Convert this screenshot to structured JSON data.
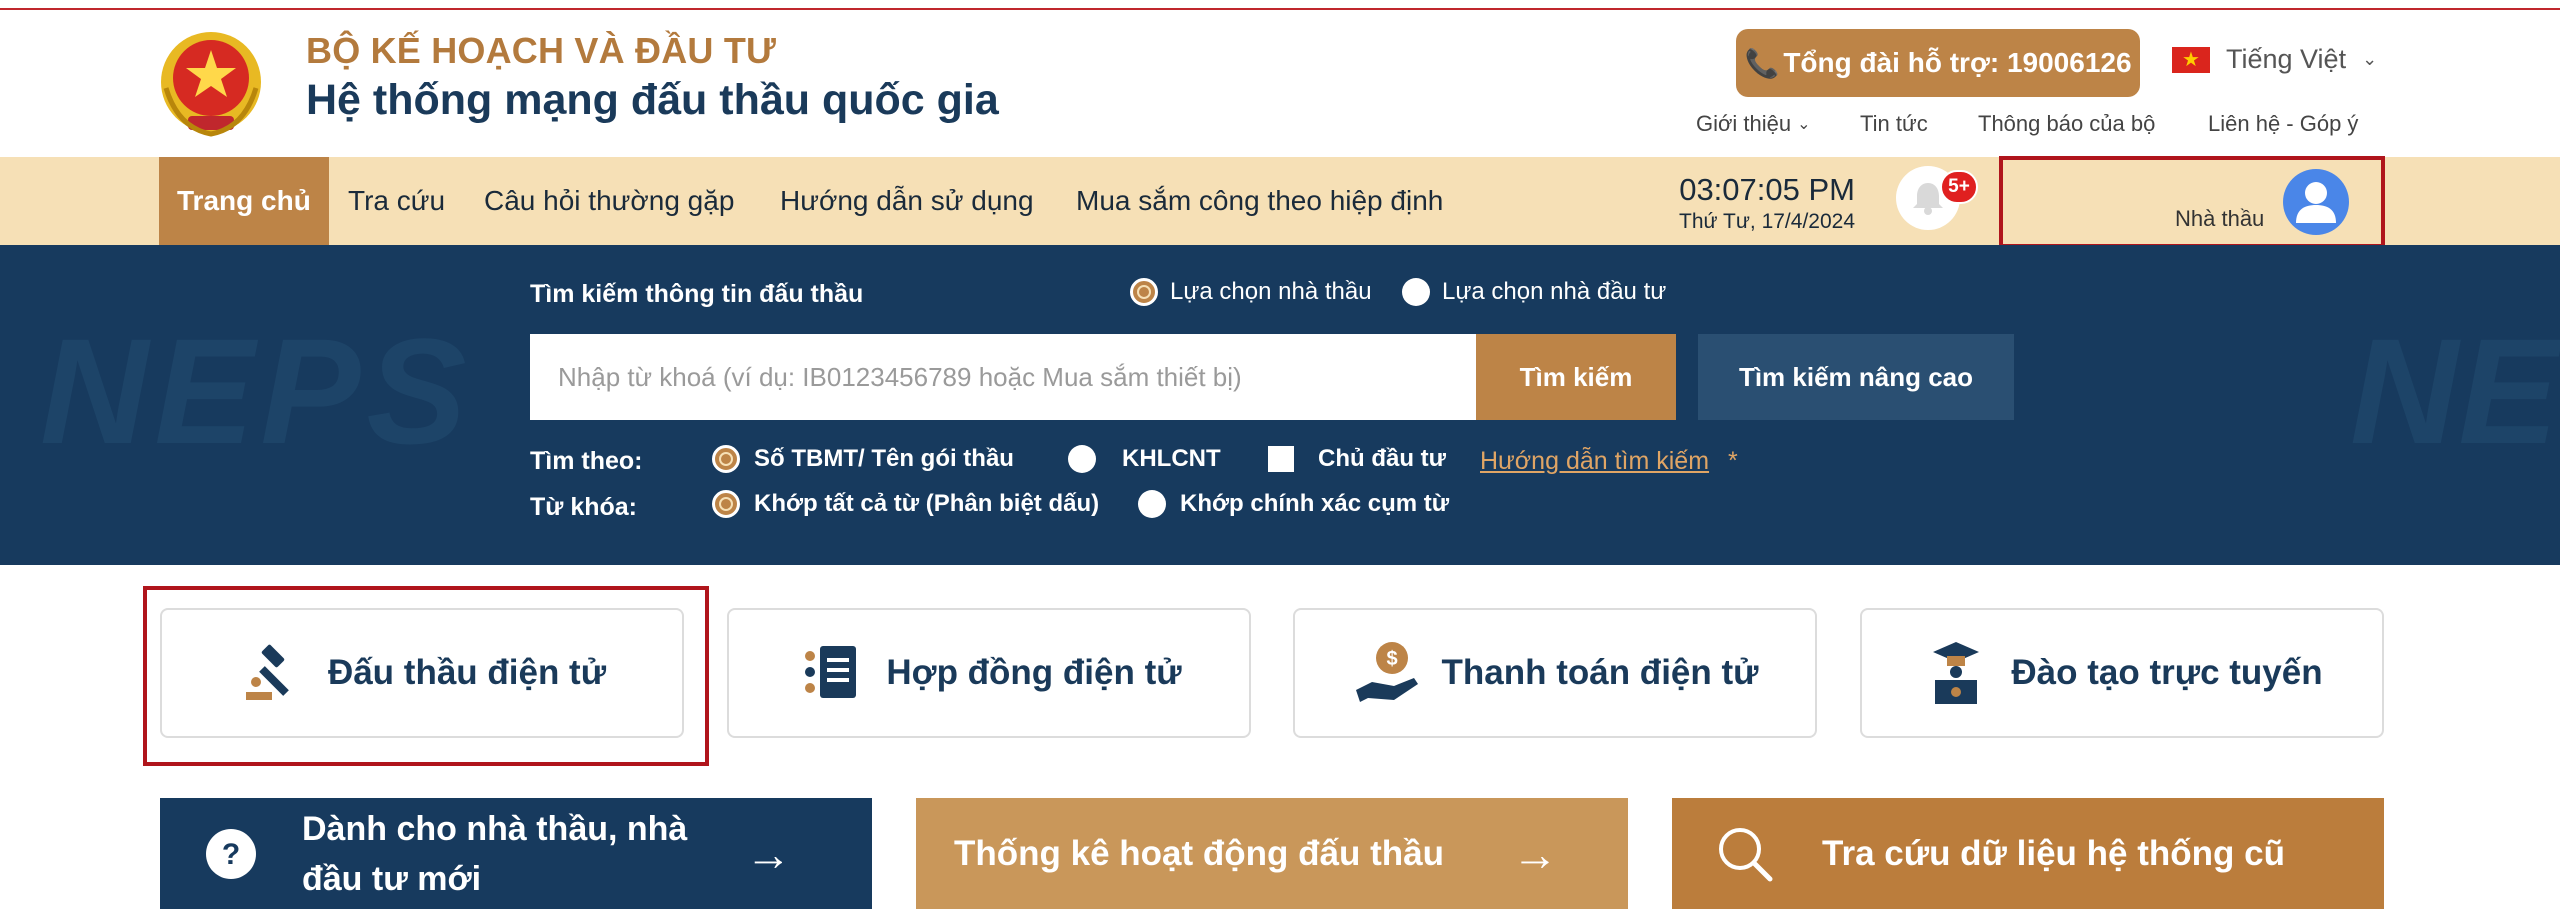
{
  "header": {
    "ministry": "BỘ KẾ HOẠCH VÀ ĐẦU TƯ",
    "system_title": "Hệ thống mạng đấu thầu quốc gia",
    "hotline": "Tổng đài hỗ trợ: 19006126",
    "language": "Tiếng Việt",
    "links": {
      "intro": "Giới thiệu",
      "news": "Tin tức",
      "ministry_notice": "Thông báo của bộ",
      "contact": "Liên hệ - Góp ý"
    }
  },
  "nav": {
    "items": [
      "Trang chủ",
      "Tra cứu",
      "Câu hỏi thường gặp",
      "Hướng dẫn sử dụng",
      "Mua sắm công theo hiệp định"
    ],
    "active_index": 0,
    "time": "03:07:05 PM",
    "date": "Thứ Tư, 17/4/2024",
    "notification_badge": "5+",
    "user_role": "Nhà thầu"
  },
  "search": {
    "label": "Tìm kiếm thông tin đấu thầu",
    "mode_options": [
      "Lựa chọn nhà thầu",
      "Lựa chọn nhà đầu tư"
    ],
    "mode_selected": "Lựa chọn nhà thầu",
    "placeholder": "Nhập từ khoá (ví dụ: IB0123456789 hoặc Mua sắm thiết bị)",
    "value": "",
    "search_button": "Tìm kiếm",
    "advanced_button": "Tìm kiếm nâng cao",
    "search_by_label": "Tìm theo:",
    "search_by_options": [
      "Số TBMT/ Tên gói thầu",
      "KHLCNT",
      "Chủ đầu tư"
    ],
    "search_by_selected": "Số TBMT/ Tên gói thầu",
    "search_guide_link": "Hướng dẫn tìm kiếm",
    "search_guide_mark": "*",
    "keyword_label": "Từ khóa:",
    "keyword_options": [
      "Khớp tất cả từ (Phân biệt dấu)",
      "Khớp chính xác cụm từ"
    ],
    "keyword_selected": "Khớp tất cả từ (Phân biệt dấu)"
  },
  "watermark": {
    "left": "NEPS",
    "right": "NE"
  },
  "services": [
    {
      "label": "Đấu thầu điện tử",
      "icon": "gavel-icon"
    },
    {
      "label": "Hợp đồng điện tử",
      "icon": "contract-icon"
    },
    {
      "label": "Thanh toán điện tử",
      "icon": "payment-icon"
    },
    {
      "label": "Đào tạo trực tuyến",
      "icon": "training-icon"
    }
  ],
  "banners": {
    "newcomers_line1": "Dành cho nhà thầu, nhà",
    "newcomers_line2": "đầu tư mới",
    "statistics": "Thống kê hoạt động đấu thầu",
    "legacy_lookup": "Tra cứu dữ liệu hệ thống cũ"
  },
  "colors": {
    "brand_gold": "#bd8447",
    "nav_bg": "#f6e0b6",
    "navy": "#173a5e",
    "highlight_red": "#b0151c"
  }
}
